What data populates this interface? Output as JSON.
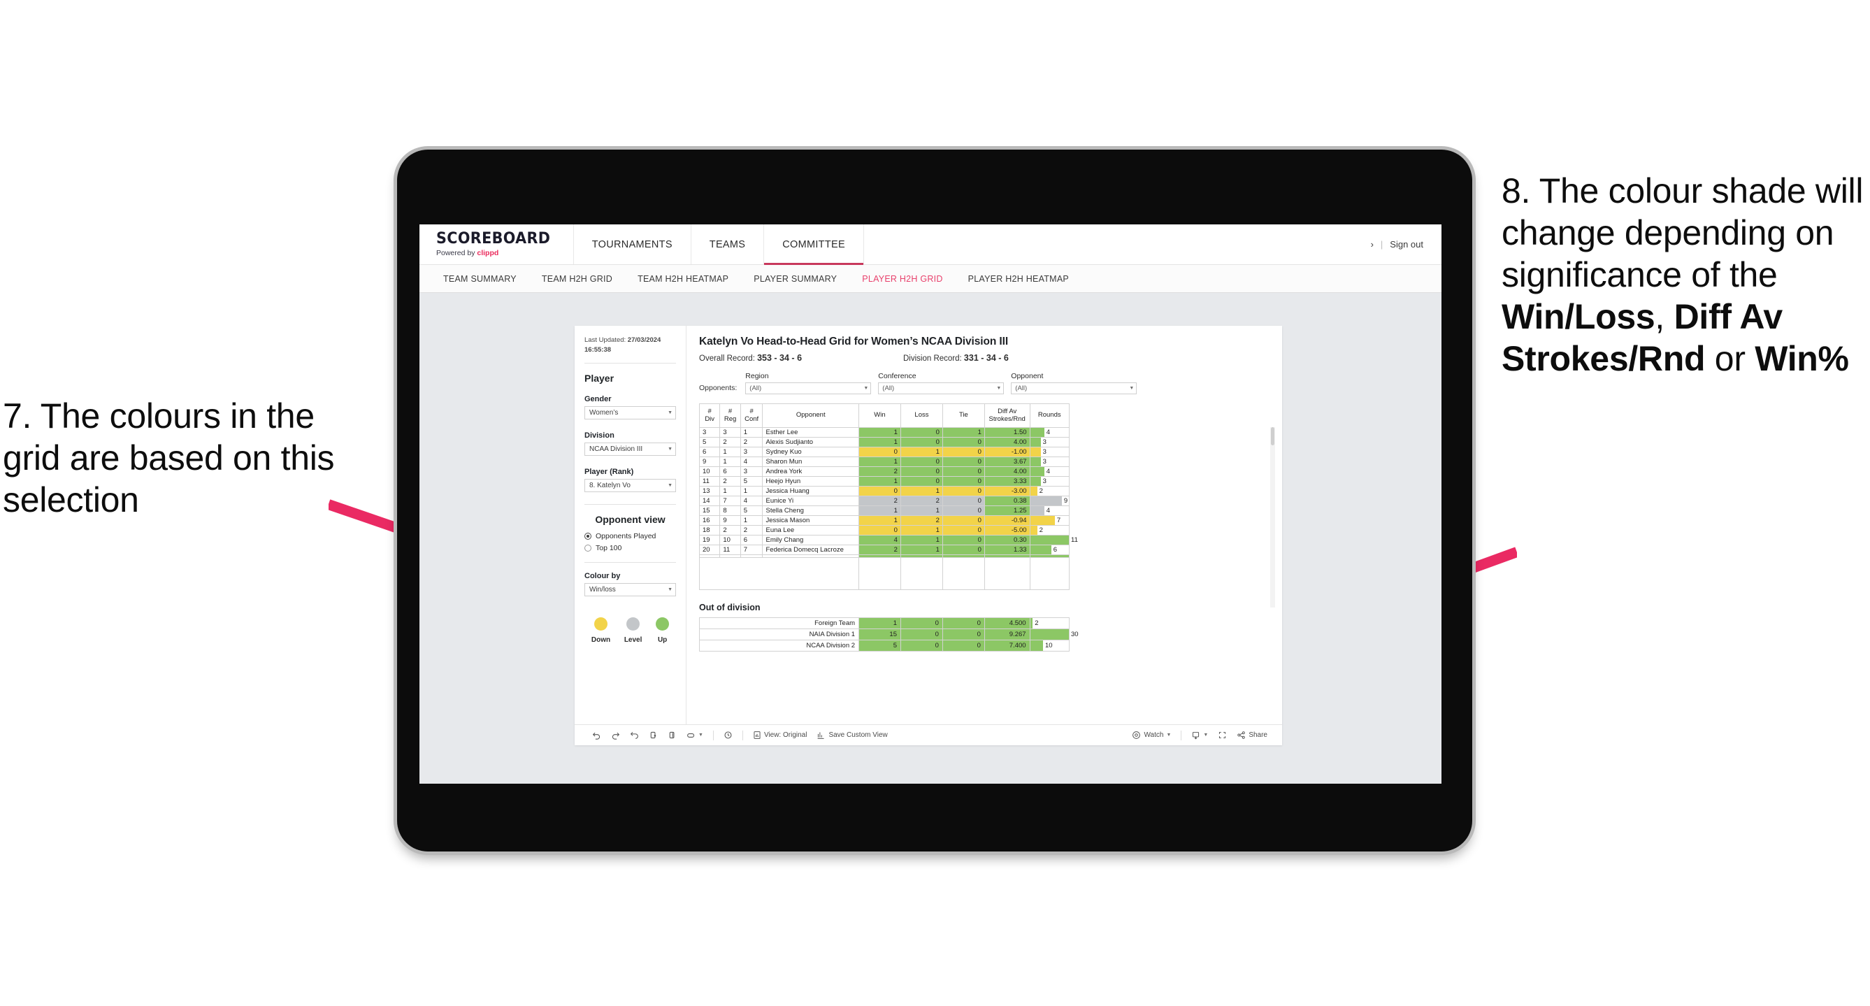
{
  "annotations": {
    "left": {
      "id": "7.",
      "text": "7. The colours in the grid are based on this selection"
    },
    "right": {
      "id": "8.",
      "line1": "8. The colour shade will change depending on significance of the ",
      "bold1": "Win/Loss",
      "mid1": ", ",
      "bold2": "Diff Av Strokes/Rnd",
      "mid2": " or ",
      "bold3": "Win%"
    },
    "arrow_color": "#ea2a63"
  },
  "topnav": {
    "brand_title": "SCOREBOARD",
    "brand_sub_prefix": "Powered by ",
    "brand_sub_brand": "clippd",
    "items": [
      {
        "label": "TOURNAMENTS",
        "active": false
      },
      {
        "label": "TEAMS",
        "active": false
      },
      {
        "label": "COMMITTEE",
        "active": true
      }
    ],
    "chevron": "›",
    "separator": "|",
    "signout": "Sign out",
    "accent": "#c8385c"
  },
  "subnav": {
    "items": [
      {
        "label": "TEAM SUMMARY",
        "active": false
      },
      {
        "label": "TEAM H2H GRID",
        "active": false
      },
      {
        "label": "TEAM H2H HEATMAP",
        "active": false
      },
      {
        "label": "PLAYER SUMMARY",
        "active": false
      },
      {
        "label": "PLAYER H2H GRID",
        "active": true
      },
      {
        "label": "PLAYER H2H HEATMAP",
        "active": false
      }
    ],
    "active_color": "#e8416c"
  },
  "sidebar": {
    "last_updated_label": "Last Updated: ",
    "last_updated_date": "27/03/2024",
    "last_updated_time": "16:55:38",
    "player_heading": "Player",
    "gender_label": "Gender",
    "gender_value": "Women’s",
    "division_label": "Division",
    "division_value": "NCAA Division III",
    "player_rank_label": "Player (Rank)",
    "player_rank_value": "8. Katelyn Vo",
    "opponent_view_heading": "Opponent view",
    "opponent_view_options": [
      {
        "label": "Opponents Played",
        "selected": true
      },
      {
        "label": "Top 100",
        "selected": false
      }
    ],
    "colour_by_label": "Colour by",
    "colour_by_value": "Win/loss",
    "legend": [
      {
        "label": "Down",
        "color": "#f2d349"
      },
      {
        "label": "Level",
        "color": "#c3c6c9"
      },
      {
        "label": "Up",
        "color": "#8cc765"
      }
    ]
  },
  "main": {
    "title": "Katelyn Vo Head-to-Head Grid for Women’s NCAA Division III",
    "overall_record_label": "Overall Record: ",
    "overall_record_value": "353 -  34 - 6",
    "division_record_label": "Division Record: ",
    "division_record_value": "331 -  34 - 6",
    "opponents_label": "Opponents:",
    "filters": [
      {
        "label": "Region",
        "value": "(All)"
      },
      {
        "label": "Conference",
        "value": "(All)"
      },
      {
        "label": "Opponent",
        "value": "(All)"
      }
    ],
    "out_of_division_title": "Out of division"
  },
  "chart_data": {
    "type": "table",
    "title": "Katelyn Vo Head-to-Head Grid for Women’s NCAA Division III",
    "columns": [
      "# Div",
      "# Reg",
      "# Conf",
      "Opponent",
      "Win",
      "Loss",
      "Tie",
      "Diff Av Strokes/Rnd",
      "Rounds"
    ],
    "column_header_lines": [
      [
        "#",
        "Div"
      ],
      [
        "#",
        "Reg"
      ],
      [
        "#",
        "Conf"
      ],
      [
        "Opponent"
      ],
      [
        "Win"
      ],
      [
        "Loss"
      ],
      [
        "Tie"
      ],
      [
        "Diff Av",
        "Strokes/Rnd"
      ],
      [
        "Rounds"
      ]
    ],
    "colour_by": "Win/loss",
    "colour_scale": {
      "up": "#8cc765",
      "level": "#c3c6c9",
      "down": "#f2d349"
    },
    "rounds_max": 11,
    "rows": [
      {
        "div": "3",
        "reg": "3",
        "conf": "1",
        "opponent": "Esther Lee",
        "win": "1",
        "loss": "0",
        "tie": "1",
        "diff": "1.50",
        "rounds": "4",
        "state": "up"
      },
      {
        "div": "5",
        "reg": "2",
        "conf": "2",
        "opponent": "Alexis Sudjianto",
        "win": "1",
        "loss": "0",
        "tie": "0",
        "diff": "4.00",
        "rounds": "3",
        "state": "up"
      },
      {
        "div": "6",
        "reg": "1",
        "conf": "3",
        "opponent": "Sydney Kuo",
        "win": "0",
        "loss": "1",
        "tie": "0",
        "diff": "-1.00",
        "rounds": "3",
        "state": "down"
      },
      {
        "div": "9",
        "reg": "1",
        "conf": "4",
        "opponent": "Sharon Mun",
        "win": "1",
        "loss": "0",
        "tie": "0",
        "diff": "3.67",
        "rounds": "3",
        "state": "up"
      },
      {
        "div": "10",
        "reg": "6",
        "conf": "3",
        "opponent": "Andrea York",
        "win": "2",
        "loss": "0",
        "tie": "0",
        "diff": "4.00",
        "rounds": "4",
        "state": "up"
      },
      {
        "div": "11",
        "reg": "2",
        "conf": "5",
        "opponent": "Heejo Hyun",
        "win": "1",
        "loss": "0",
        "tie": "0",
        "diff": "3.33",
        "rounds": "3",
        "state": "up"
      },
      {
        "div": "13",
        "reg": "1",
        "conf": "1",
        "opponent": "Jessica Huang",
        "win": "0",
        "loss": "1",
        "tie": "0",
        "diff": "-3.00",
        "rounds": "2",
        "state": "down"
      },
      {
        "div": "14",
        "reg": "7",
        "conf": "4",
        "opponent": "Eunice Yi",
        "win": "2",
        "loss": "2",
        "tie": "0",
        "diff": "0.38",
        "rounds": "9",
        "state": "level",
        "diff_state": "up"
      },
      {
        "div": "15",
        "reg": "8",
        "conf": "5",
        "opponent": "Stella Cheng",
        "win": "1",
        "loss": "1",
        "tie": "0",
        "diff": "1.25",
        "rounds": "4",
        "state": "level",
        "diff_state": "up"
      },
      {
        "div": "16",
        "reg": "9",
        "conf": "1",
        "opponent": "Jessica Mason",
        "win": "1",
        "loss": "2",
        "tie": "0",
        "diff": "-0.94",
        "rounds": "7",
        "state": "down"
      },
      {
        "div": "18",
        "reg": "2",
        "conf": "2",
        "opponent": "Euna Lee",
        "win": "0",
        "loss": "1",
        "tie": "0",
        "diff": "-5.00",
        "rounds": "2",
        "state": "down"
      },
      {
        "div": "19",
        "reg": "10",
        "conf": "6",
        "opponent": "Emily Chang",
        "win": "4",
        "loss": "1",
        "tie": "0",
        "diff": "0.30",
        "rounds": "11",
        "state": "up"
      },
      {
        "div": "20",
        "reg": "11",
        "conf": "7",
        "opponent": "Federica Domecq Lacroze",
        "win": "2",
        "loss": "1",
        "tie": "0",
        "diff": "1.33",
        "rounds": "6",
        "state": "up"
      }
    ],
    "out_of_division": {
      "rounds_max": 30,
      "rows": [
        {
          "name": "Foreign Team",
          "win": "1",
          "loss": "0",
          "tie": "0",
          "diff": "4.500",
          "rounds": "2",
          "state": "up"
        },
        {
          "name": "NAIA Division 1",
          "win": "15",
          "loss": "0",
          "tie": "0",
          "diff": "9.267",
          "rounds": "30",
          "state": "up"
        },
        {
          "name": "NCAA Division 2",
          "win": "5",
          "loss": "0",
          "tie": "0",
          "diff": "7.400",
          "rounds": "10",
          "state": "up"
        }
      ]
    }
  },
  "viz_toolbar": {
    "undo": "undo-icon",
    "redo": "redo-icon",
    "revert": "revert-icon",
    "refresh": "refresh-icon",
    "pause": "pause-icon",
    "view_original": "View: Original",
    "save_custom_view": "Save Custom View",
    "watch": "Watch",
    "share": "Share"
  }
}
